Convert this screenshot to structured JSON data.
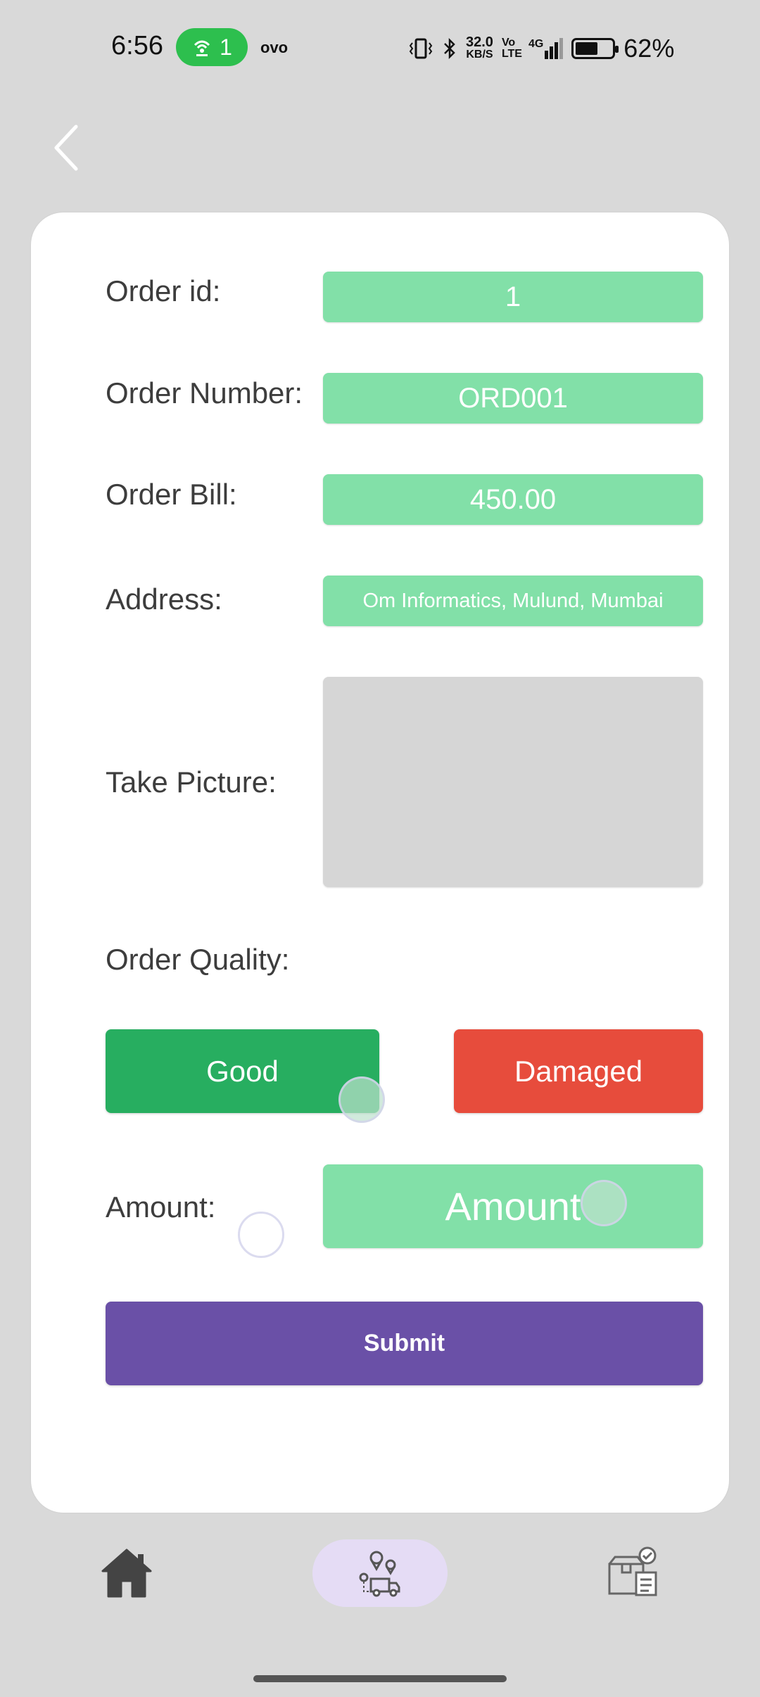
{
  "status_bar": {
    "time": "6:56",
    "hotspot_count": "1",
    "carrier": "ovo",
    "speed_value": "32.0",
    "speed_unit": "KB/S",
    "volte": "Vo LTE",
    "network": "4G",
    "battery_percent": "62%",
    "battery_level": 0.62
  },
  "form": {
    "order_id_label": "Order id:",
    "order_id_value": "1",
    "order_number_label": "Order Number:",
    "order_number_value": "ORD001",
    "order_bill_label": "Order Bill:",
    "order_bill_value": "450.00",
    "address_label": "Address:",
    "address_value": "Om Informatics, Mulund, Mumbai",
    "take_picture_label": "Take Picture:",
    "order_quality_label": "Order Quality:",
    "good_label": "Good",
    "damaged_label": "Damaged",
    "amount_label": "Amount:",
    "amount_placeholder": "Amount",
    "submit_label": "Submit"
  },
  "colors": {
    "field_green": "#82e0a8",
    "good_green": "#27ae60",
    "damaged_red": "#e74c3c",
    "submit_purple": "#6a50a7",
    "nav_active_bg": "#e5dcf5"
  },
  "icons": {
    "back": "chevron-left-icon",
    "home": "home-icon",
    "delivery": "delivery-route-icon",
    "orders": "delivered-package-icon"
  }
}
